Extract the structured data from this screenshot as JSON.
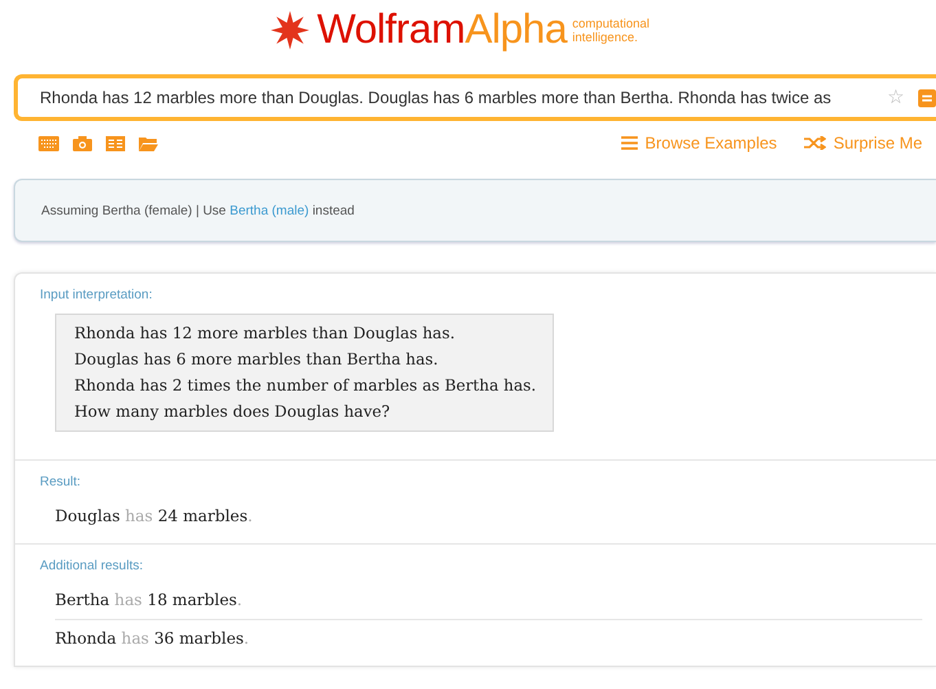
{
  "logo": {
    "brand_first": "Wolfram",
    "brand_second": "Alpha",
    "tagline": "computational intelligence."
  },
  "search": {
    "value": "Rhonda has 12 marbles more than Douglas. Douglas has 6 marbles more than Bertha. Rhonda has twice as",
    "star": "☆"
  },
  "toolbar": {
    "links": [
      {
        "label": "Browse Examples",
        "kind": "menu"
      },
      {
        "label": "Surprise Me",
        "kind": "shuffle"
      }
    ]
  },
  "assumption": {
    "text": "Assuming Bertha (female) | Use",
    "link": "Bertha (male)",
    "after": "instead"
  },
  "pods": [
    {
      "title": "Input interpretation:",
      "kind": "box",
      "lines": [
        "Rhonda has 12 more marbles than Douglas has.",
        "Douglas has 6 more marbles than Bertha has.",
        "Rhonda has 2 times the number of marbles as Bertha has.",
        "How many marbles does Douglas have?"
      ]
    },
    {
      "title": "Result:",
      "kind": "rows",
      "rows": [
        {
          "segments": [
            {
              "text": "Douglas",
              "dim": false
            },
            {
              "text": "has",
              "dim": true
            },
            {
              "text": "24 marbles",
              "dim": false
            },
            {
              "text": ".",
              "dim": true
            }
          ]
        }
      ]
    },
    {
      "title": "Additional results:",
      "kind": "rows",
      "rows": [
        {
          "segments": [
            {
              "text": "Bertha",
              "dim": false
            },
            {
              "text": "has",
              "dim": true
            },
            {
              "text": "18 marbles",
              "dim": false
            },
            {
              "text": ".",
              "dim": true
            }
          ]
        },
        {
          "segments": [
            {
              "text": "Rhonda",
              "dim": false
            },
            {
              "text": "has",
              "dim": true
            },
            {
              "text": "36 marbles",
              "dim": false
            },
            {
              "text": ".",
              "dim": true
            }
          ]
        }
      ]
    }
  ]
}
